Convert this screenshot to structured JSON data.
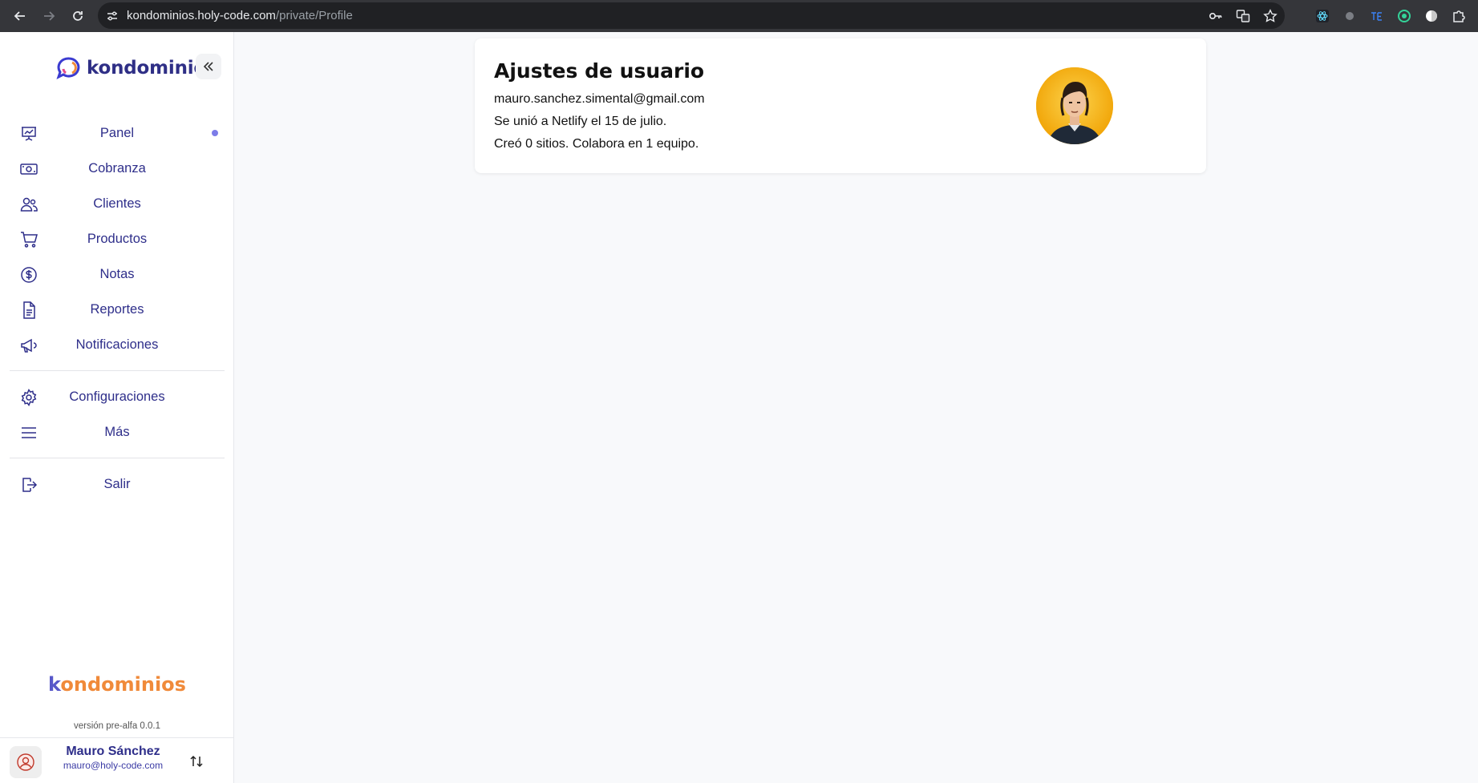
{
  "browser": {
    "url_host": "kondominios.holy-code.com",
    "url_path": "/private/Profile"
  },
  "sidebar": {
    "brand": "kondominios",
    "items": [
      {
        "label": "Panel",
        "icon": "presentation-chart-icon",
        "active": true
      },
      {
        "label": "Cobranza",
        "icon": "cash-icon"
      },
      {
        "label": "Clientes",
        "icon": "users-icon"
      },
      {
        "label": "Productos",
        "icon": "cart-icon"
      },
      {
        "label": "Notas",
        "icon": "dollar-circle-icon"
      },
      {
        "label": "Reportes",
        "icon": "document-icon"
      },
      {
        "label": "Notificaciones",
        "icon": "megaphone-icon"
      }
    ],
    "settings_items": [
      {
        "label": "Configuraciones",
        "icon": "gear-icon"
      },
      {
        "label": "Más",
        "icon": "menu-icon"
      }
    ],
    "logout": {
      "label": "Salir",
      "icon": "logout-icon"
    },
    "footer_brand_first": "k",
    "footer_brand_rest": "ondominios",
    "version": "versión pre-alfa 0.0.1",
    "user": {
      "name": "Mauro Sánchez",
      "email": "mauro@holy-code.com"
    }
  },
  "profile_card": {
    "title": "Ajustes de usuario",
    "email": "mauro.sanchez.simental@gmail.com",
    "joined": "Se unió a Netlify el 15 de julio.",
    "stats": "Creó 0 sitios. Colabora en 1 equipo."
  },
  "colors": {
    "accent": "#2e2e8a",
    "brand_orange": "#f08a3a",
    "brand_purple": "#5757c9",
    "active_dot": "#7c7ce8"
  }
}
